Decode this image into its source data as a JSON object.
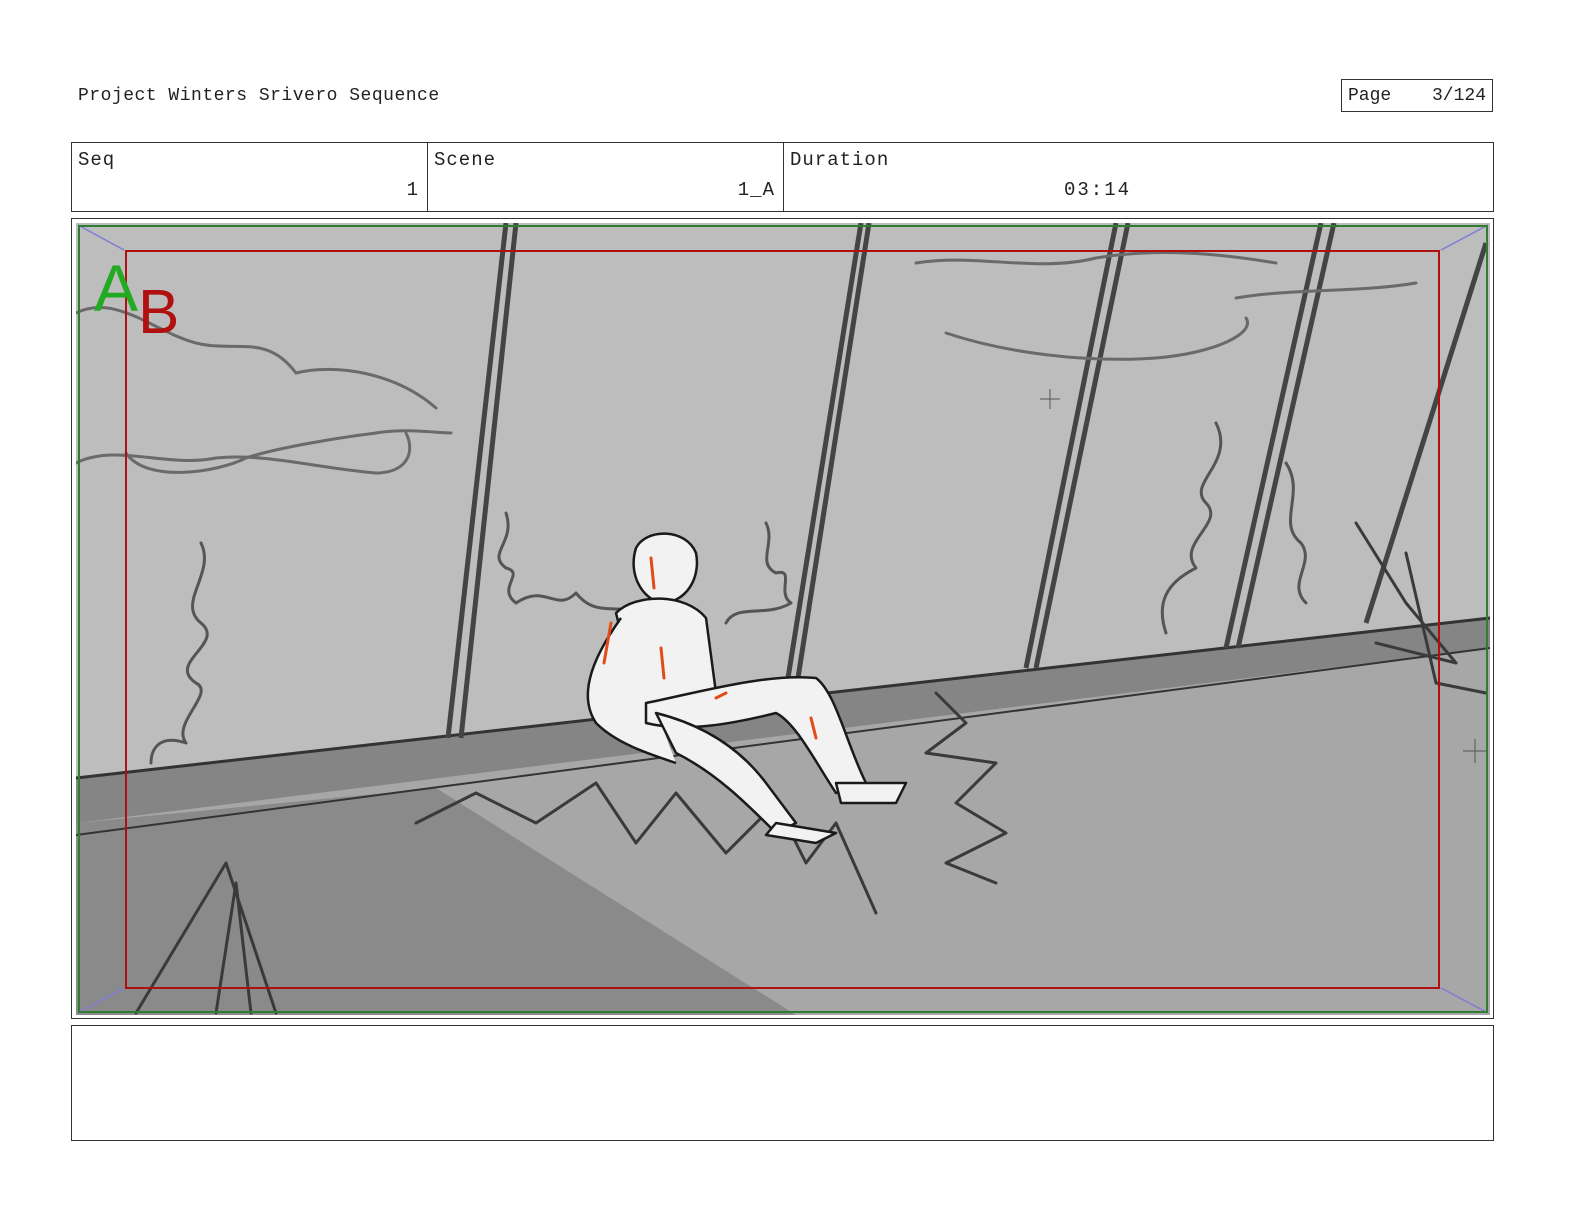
{
  "header": {
    "project_title": "Project Winters Srivero Sequence",
    "page_label": "Page",
    "page_number": "3/124"
  },
  "info": {
    "seq_label": "Seq",
    "seq_value": "1",
    "scene_label": "Scene",
    "scene_value": "1_A",
    "duration_label": "Duration",
    "duration_value": "03:14"
  },
  "panel": {
    "marker_a": "A",
    "marker_b": "B",
    "marker_a_color": "#22aa22",
    "marker_b_color": "#b01010",
    "safe_frame_color": "#b01010",
    "outer_frame_color": "#2e7d32"
  },
  "notes": {
    "text": ""
  }
}
